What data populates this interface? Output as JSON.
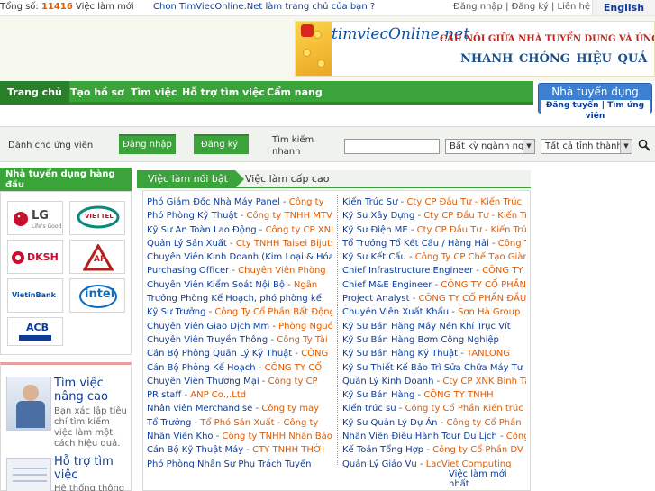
{
  "topbar": {
    "stats_prefix": "Tổng số:",
    "stats_count": "11416",
    "stats_suffix": "Việc làm mới",
    "promo": "Chọn TimViecOnline.Net làm trang chủ của bạn ?",
    "login": "Đăng nhập",
    "register": "Đăng ký",
    "contact": "Liên hệ",
    "separator": "|",
    "language": "English"
  },
  "banner": {
    "logo": "timviecOnline.net",
    "slogan_line1": "CẦU NỐI GIỮA NHÀ TUYỂN DỤNG VÀ ỨNG VIÊN",
    "slogan_line2": "NHANH CHÓNG   HIỆU QUẢ"
  },
  "nav": {
    "tabs": [
      "Trang chủ",
      "Tạo hồ sơ",
      "Tìm việc",
      "Hỗ trợ tìm việc",
      "Cẩm nang"
    ],
    "employer_title": "Nhà tuyển dụng",
    "employer_post": "Đăng tuyển",
    "employer_find": "Tìm ứng viên",
    "employer_sep": "|"
  },
  "search": {
    "candidate_label": "Dành cho ứng viên",
    "login_button": "Đăng nhập",
    "register_button": "Đăng ký",
    "search_label": "Tìm kiếm nhanh",
    "industry_select": "Bất kỳ ngành nghề",
    "province_select": "Tất cả tỉnh thành"
  },
  "sidebar": {
    "employers_title": "Nhà tuyển dụng hàng đầu",
    "logos": [
      "LG",
      "VIETTEL",
      "DKSH",
      "AP",
      "VietinBank",
      "intel",
      "ACB"
    ],
    "lg_tagline": "Life's Good",
    "promo1_title": "Tìm việc nâng cao",
    "promo1_desc": "Bạn xác lập tiêu chí tìm kiếm việc làm một cách hiệu quả.",
    "promo2_title": "Hỗ trợ tìm việc",
    "promo2_desc": "Hệ thống thông"
  },
  "main": {
    "tab_featured": "Việc làm nổi bật",
    "tab_senior": "Việc làm cấp cao",
    "separator": " - ",
    "left_jobs": [
      {
        "title": "Phó Giám Đốc Nhà Máy Panel",
        "company": "Công ty"
      },
      {
        "title": "Phó Phòng Kỹ Thuật",
        "company": "Công ty TNHH MTV"
      },
      {
        "title": "Kỹ Sư An Toàn Lao Động",
        "company": "Công ty CP XNK"
      },
      {
        "title": "Quản Lý Sản Xuất",
        "company": "Cty TNHH Taisei Bijutsu"
      },
      {
        "title": "Chuyên Viên Kinh Doanh (Kim Loại & Hóa",
        "company": ""
      },
      {
        "title": "Purchasing Officer",
        "company": "Chuyên Viên Phòng"
      },
      {
        "title": "Chuyên Viên Kiểm Soát Nội Bộ",
        "company": "Ngân"
      },
      {
        "title": "Trưởng Phòng Kế Hoạch, phó phòng kế",
        "company": ""
      },
      {
        "title": "Kỹ Sư Trưởng",
        "company": "Công Ty Cổ Phần Bất Động"
      },
      {
        "title": "Chuyên Viên Giao Dịch Mm",
        "company": "Phòng Nguồn"
      },
      {
        "title": "Chuyên Viên Truyền Thông",
        "company": "Công Ty Tài"
      },
      {
        "title": "Cán Bộ Phòng Quản Lý Kỹ Thuật",
        "company": "CÔNG TY"
      },
      {
        "title": "Cán Bộ Phòng Kế Hoạch",
        "company": "CÔNG TY CỔ"
      },
      {
        "title": "Chuyên Viên Thương Mại",
        "company": "Công ty CP"
      },
      {
        "title": "PR staff",
        "company": "ANP Co.,.Ltd"
      },
      {
        "title": "Nhân viên Merchandise",
        "company": "Công ty may"
      },
      {
        "title": "Tổ Trưởng",
        "company": "Tổ Phó Sản Xuất - Công ty"
      },
      {
        "title": "Nhân Viên Kho",
        "company": "Công ty TNHH Nhân Bảo"
      },
      {
        "title": "Cán Bộ Kỹ Thuật Máy",
        "company": "CTY TNHH THỜI"
      },
      {
        "title": "Phó Phòng Nhân Sự Phụ Trách Tuyển",
        "company": ""
      }
    ],
    "right_jobs": [
      {
        "title": "Kiến Trúc Sư",
        "company": "Cty CP Đầu Tư - Kiến Trúc"
      },
      {
        "title": "Kỹ Sư Xây Dựng",
        "company": "Cty CP Đầu Tư - Kiến Trúc"
      },
      {
        "title": "Kỹ Sư Điện ME",
        "company": "Cty CP Đầu Tư - Kiến Trúc"
      },
      {
        "title": "Tổ Trưởng Tổ Kết Cấu / Hàng Hải",
        "company": "Công Ty"
      },
      {
        "title": "Kỹ Sư Kết Cấu",
        "company": "Công Ty CP Chế Tạo Giàn"
      },
      {
        "title": "Chief Infrastructure Engineer",
        "company": "CÔNG TY"
      },
      {
        "title": "Chief M&E Engineer",
        "company": "CÔNG TY CỔ PHẦN"
      },
      {
        "title": "Project Analyst",
        "company": "CÔNG TY CỔ PHẦN ĐẦU"
      },
      {
        "title": "Chuyên Viên Xuất Khẩu",
        "company": "Sơn Hà Group"
      },
      {
        "title": "Kỹ Sư Bán Hàng Máy Nén Khí Trục Vít",
        "company": ""
      },
      {
        "title": "Kỹ Sư Bán Hàng Bơm Công Nghiệp",
        "company": ""
      },
      {
        "title": "Kỹ Sư Bán Hàng Kỹ Thuật",
        "company": "TANLONG"
      },
      {
        "title": "Kỹ Sư Thiết Kế Bảo Trì Sửa Chữa Máy Tư",
        "company": ""
      },
      {
        "title": "Quản Lý Kinh Doanh",
        "company": "Cty CP XNK Bình Tây"
      },
      {
        "title": "Kỹ Sư Bán Hàng",
        "company": "CÔNG TY TNHH"
      },
      {
        "title": "Kiến trúc sư",
        "company": "Công ty Cổ Phần Kiến trúc"
      },
      {
        "title": "Kỹ Sư Quản Lý Dự Án",
        "company": "Công ty Cổ Phần"
      },
      {
        "title": "Nhân Viên Điều Hành Tour Du Lịch",
        "company": "Công"
      },
      {
        "title": "Kế Toán Tổng Hợp",
        "company": "Công ty Cổ Phần DV"
      },
      {
        "title": "Quản Lý Giáo Vụ",
        "company": "LacViet Computing"
      }
    ],
    "more_link": "Việc làm mới nhất"
  },
  "colors": {
    "green": "#3aa339",
    "blue_link": "#0b3c9b",
    "orange": "#e05a00"
  }
}
